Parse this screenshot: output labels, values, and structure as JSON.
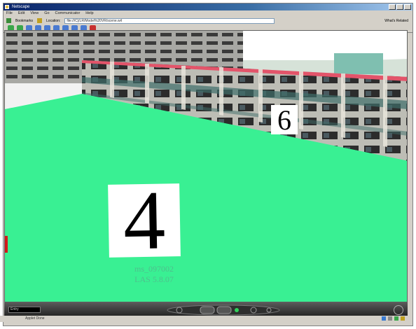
{
  "window": {
    "title": "Netscape"
  },
  "menu": {
    "items": [
      "File",
      "Edit",
      "View",
      "Go",
      "Communicator",
      "Help"
    ]
  },
  "address": {
    "bookmarks_label": "Bookmarks",
    "location_label": "Location:",
    "url": "file:///C|/LR/Model%20VR/scene.wrl",
    "related_label": "What's Related"
  },
  "scene": {
    "marker_near": "4",
    "marker_far": "6",
    "caption_line1": "ms_097002",
    "caption_line2": "LAS 5.8.07"
  },
  "nav": {
    "viewpoint": "Entry"
  },
  "status": {
    "left": "",
    "middle": "Applet Done"
  },
  "colors": {
    "ground": "#39f093",
    "roof": "#e3546a",
    "building": "#c9c9c9",
    "sky": "#ffffff"
  }
}
